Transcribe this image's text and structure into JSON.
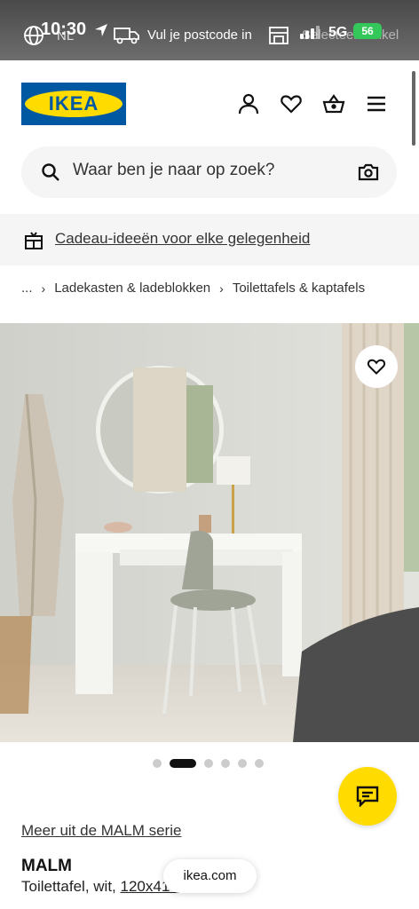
{
  "status_bar": {
    "time": "10:30",
    "network": "5G",
    "battery": "56"
  },
  "utility_bar": {
    "language": "NL",
    "postcode_label": "Vul je postcode in",
    "store_label": "Selecteer winkel"
  },
  "header": {
    "logo_text": "IKEA",
    "icons": [
      "user-icon",
      "heart-icon",
      "basket-icon",
      "menu-icon"
    ]
  },
  "search": {
    "placeholder": "Waar ben je naar op zoek?"
  },
  "promo": {
    "label": "Cadeau-ideeën voor elke gelegenheid"
  },
  "breadcrumb": {
    "items": [
      "...",
      "Ladekasten & ladeblokken",
      "Toilettafels & kaptafels"
    ]
  },
  "gallery": {
    "total_images": 6,
    "active_index": 1
  },
  "product": {
    "series_link": "Meer uit de MALM serie",
    "name": "MALM",
    "description_prefix": "Toilettafel, wit, ",
    "dimensions": "120x41 cm"
  },
  "browser": {
    "url": "ikea.com"
  },
  "colors": {
    "brand_blue": "#0058a3",
    "brand_yellow": "#ffdb00"
  }
}
